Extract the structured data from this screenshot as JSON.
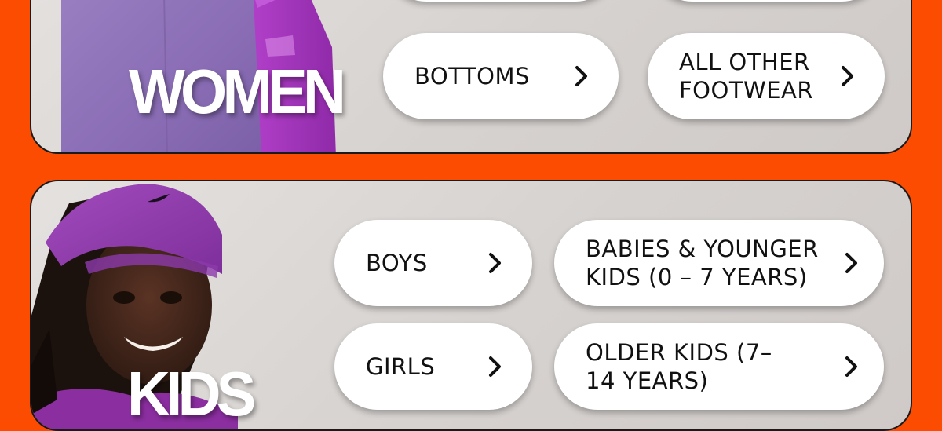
{
  "sections": {
    "women": {
      "title": "WOMEN",
      "buttons": [
        {
          "label": "BOTTOMS"
        },
        {
          "label": "ALL OTHER FOOTWEAR"
        }
      ]
    },
    "kids": {
      "title": "KIDS",
      "buttons": [
        {
          "label": "BOYS"
        },
        {
          "label": "BABIES & YOUNGER KIDS (0 – 7 YEARS)"
        },
        {
          "label": "GIRLS"
        },
        {
          "label": "OLDER KIDS (7– 14 YEARS)"
        }
      ]
    }
  },
  "icons": {
    "chevron": "chevron-right-icon",
    "logo": "swoosh-logo-icon"
  },
  "colors": {
    "background": "#fc4c02",
    "panel": "#dcd8d6",
    "button": "#ffffff",
    "text": "#111111",
    "title": "#ffffff"
  }
}
